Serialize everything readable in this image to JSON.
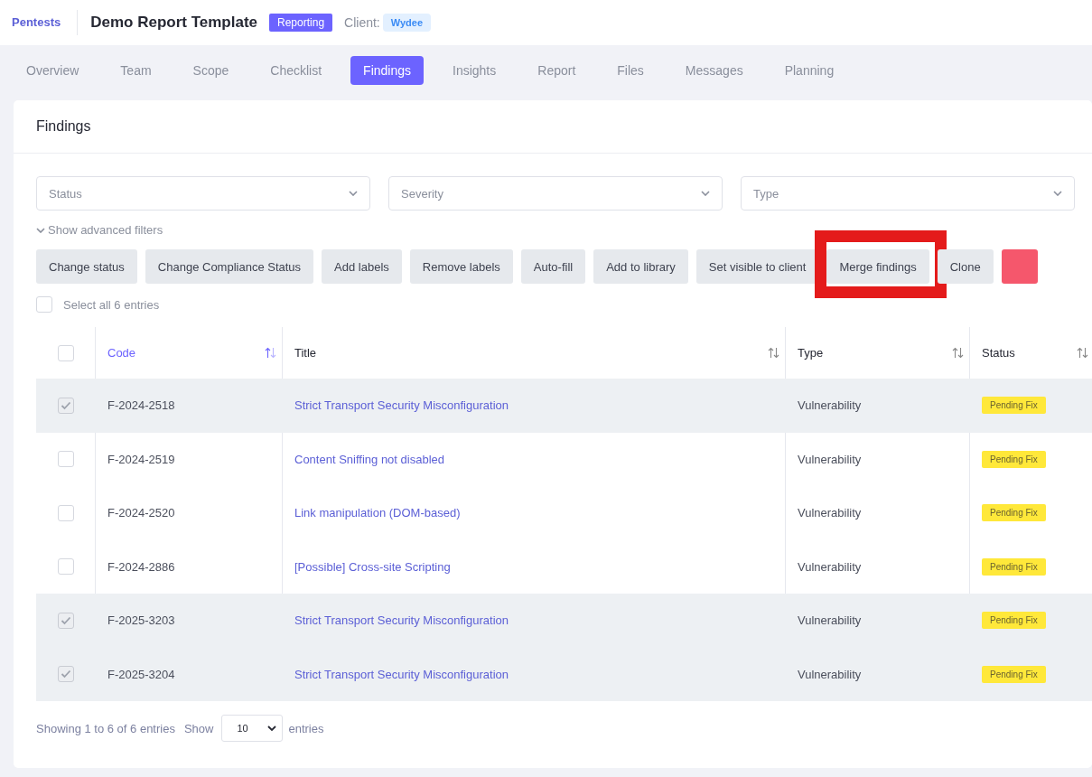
{
  "header": {
    "breadcrumb": "Pentests",
    "title": "Demo Report Template",
    "phase_badge": "Reporting",
    "client_label": "Client:",
    "client": "Wydee"
  },
  "tabs": [
    {
      "label": "Overview",
      "selected": false
    },
    {
      "label": "Team",
      "selected": false
    },
    {
      "label": "Scope",
      "selected": false
    },
    {
      "label": "Checklist",
      "selected": false
    },
    {
      "label": "Findings",
      "selected": true
    },
    {
      "label": "Insights",
      "selected": false
    },
    {
      "label": "Report",
      "selected": false
    },
    {
      "label": "Files",
      "selected": false
    },
    {
      "label": "Messages",
      "selected": false
    },
    {
      "label": "Planning",
      "selected": false
    }
  ],
  "card": {
    "title": "Findings",
    "filters": [
      {
        "placeholder": "Status"
      },
      {
        "placeholder": "Severity"
      },
      {
        "placeholder": "Type"
      }
    ],
    "advanced_filters": "Show advanced filters",
    "actions": [
      {
        "kind": "default",
        "label": "Change status",
        "highlighted": false
      },
      {
        "kind": "default",
        "label": "Change Compliance Status",
        "highlighted": false
      },
      {
        "kind": "default",
        "label": "Add labels",
        "highlighted": false
      },
      {
        "kind": "default",
        "label": "Remove labels",
        "highlighted": false
      },
      {
        "kind": "default",
        "label": "Auto-fill",
        "highlighted": false
      },
      {
        "kind": "default",
        "label": "Add to library",
        "highlighted": false
      },
      {
        "kind": "default",
        "label": "Set visible to client",
        "highlighted": false
      },
      {
        "kind": "default",
        "label": "Merge findings",
        "highlighted": true
      },
      {
        "kind": "default",
        "label": "Clone",
        "highlighted": false
      },
      {
        "kind": "danger",
        "highlighted": false
      }
    ],
    "select_all": {
      "label": "Select all 6 entries",
      "checked": false
    },
    "table": {
      "header_checked": false,
      "columns": [
        {
          "label": "Code",
          "sorted": true
        },
        {
          "label": "Title",
          "sorted": false
        },
        {
          "label": "Type",
          "sorted": false
        },
        {
          "label": "Status",
          "sorted": false
        }
      ],
      "rows": [
        {
          "selected": true,
          "checked": true,
          "code": "F-2024-2518",
          "title": "Strict Transport Security Misconfiguration",
          "type": "Vulnerability",
          "status": "Pending Fix"
        },
        {
          "selected": false,
          "checked": false,
          "code": "F-2024-2519",
          "title": "Content Sniffing not disabled",
          "type": "Vulnerability",
          "status": "Pending Fix"
        },
        {
          "selected": false,
          "checked": false,
          "code": "F-2024-2520",
          "title": "Link manipulation (DOM-based)",
          "type": "Vulnerability",
          "status": "Pending Fix"
        },
        {
          "selected": false,
          "checked": false,
          "code": "F-2024-2886",
          "title": "[Possible] Cross-site Scripting",
          "type": "Vulnerability",
          "status": "Pending Fix"
        },
        {
          "selected": true,
          "checked": true,
          "code": "F-2025-3203",
          "title": "Strict Transport Security Misconfiguration",
          "type": "Vulnerability",
          "status": "Pending Fix"
        },
        {
          "selected": true,
          "checked": true,
          "code": "F-2025-3204",
          "title": "Strict Transport Security Misconfiguration",
          "type": "Vulnerability",
          "status": "Pending Fix"
        }
      ]
    },
    "footer": {
      "info": "Showing 1 to 6 of 6 entries",
      "show_label": "Show",
      "page_size": "10",
      "entries_label": "entries"
    }
  }
}
